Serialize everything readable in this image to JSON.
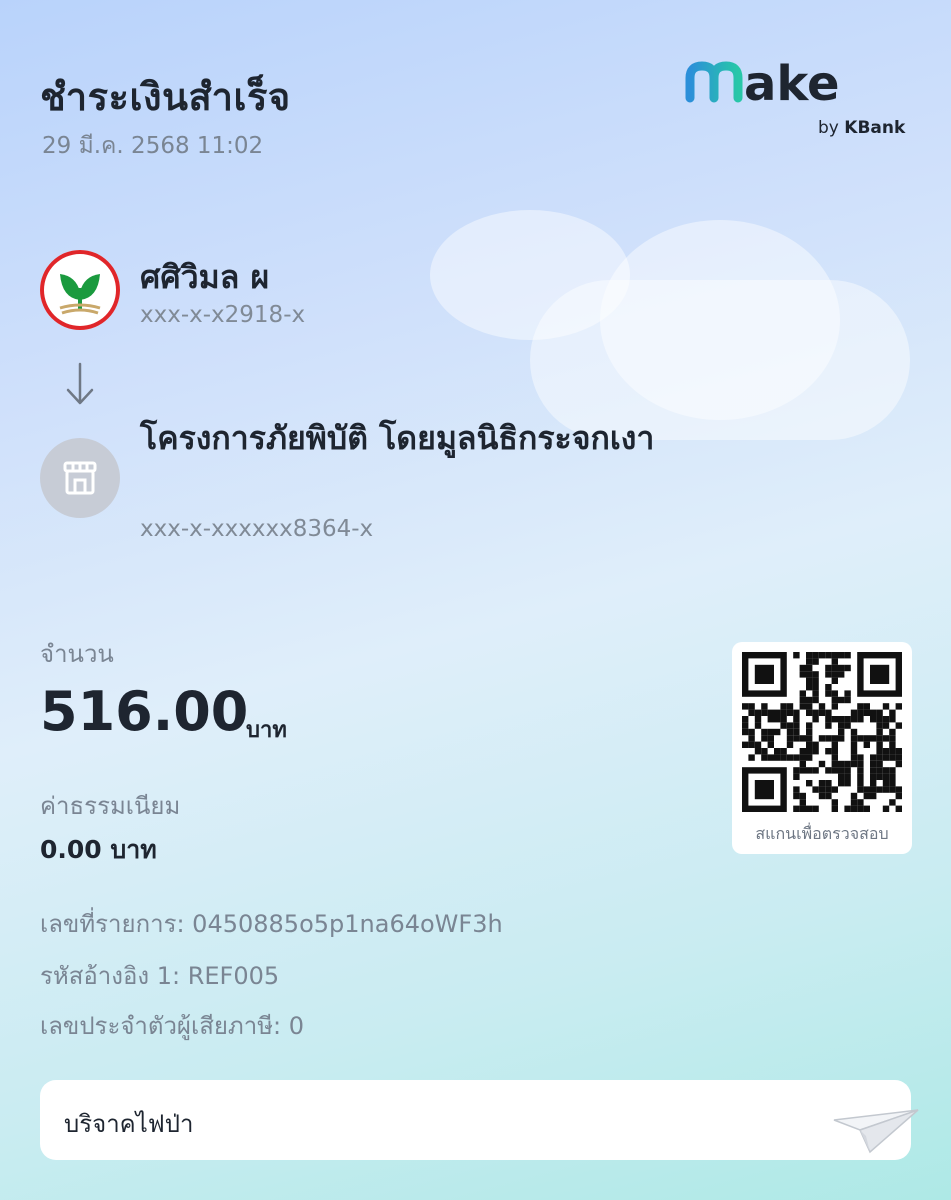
{
  "header": {
    "title": "ชำระเงินสำเร็จ",
    "datetime": "29 มี.ค. 2568 11:02"
  },
  "brand": {
    "logo_text": "make",
    "logo_sub_by": "by",
    "logo_sub_bank": "KBank",
    "colors": {
      "logo_gradient_start": "#2b8fd9",
      "logo_gradient_end": "#28c7a8",
      "logo_text": "#1e2530",
      "kbank_green": "#1a9a3e",
      "kbank_red": "#e0262a"
    }
  },
  "sender": {
    "icon": "kbank-logo-icon",
    "name": "ศศิวิมล ผ",
    "account": "xxx-x-x2918-x"
  },
  "transfer": {
    "arrow_icon": "arrow-down-icon"
  },
  "receiver": {
    "icon": "store-icon",
    "name": "โครงการภัยพิบัติ โดยมูลนิธิกระจกเงา",
    "account": "xxx-x-xxxxxx8364-x"
  },
  "amount": {
    "label": "จำนวน",
    "value": "516.00",
    "unit": "บาท"
  },
  "fee": {
    "label": "ค่าธรรมเนียม",
    "value": "0.00 บาท"
  },
  "details": {
    "transaction_id": "เลขที่รายการ: 0450885o5p1na64oWF3h",
    "ref1": "รหัสอ้างอิง 1: REF005",
    "tax_id": "เลขประจำตัวผู้เสียภาษี: 0"
  },
  "qr": {
    "caption": "สแกนเพื่อตรวจสอบ"
  },
  "note": {
    "text": "บริจาคไฟป่า",
    "icon": "paper-plane-icon"
  }
}
